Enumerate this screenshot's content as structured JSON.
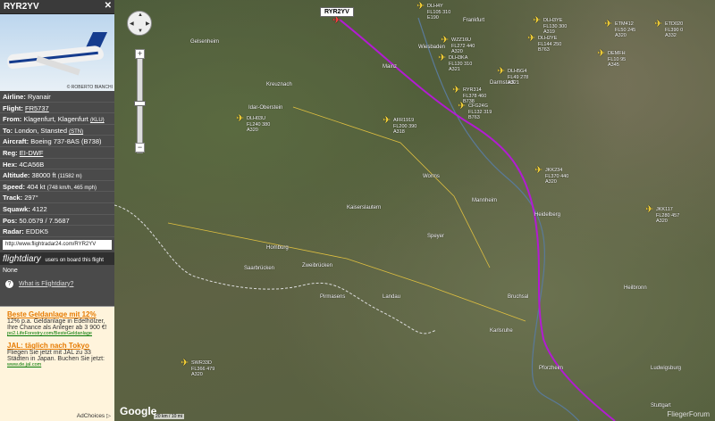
{
  "sidebar": {
    "title": "RYR2YV",
    "close": "✕",
    "photo_credit": "© ROBERTO BIANCHI",
    "rows": [
      {
        "label": "Airline:",
        "value": "Ryanair"
      },
      {
        "label": "Flight:",
        "value": "FR5737"
      },
      {
        "label": "From:",
        "value": "Klagenfurt, Klagenfurt",
        "code": "(KLU)"
      },
      {
        "label": "To:",
        "value": "London, Stansted",
        "code": "(STN)"
      },
      {
        "label": "Aircraft:",
        "value": "Boeing 737-8AS (B738)"
      },
      {
        "label": "Reg:",
        "value": "EI-DWF"
      },
      {
        "label": "Hex:",
        "value": "4CA56B"
      },
      {
        "label": "Altitude:",
        "value": "38000 ft",
        "extra": "(11582 m)"
      },
      {
        "label": "Speed:",
        "value": "404 kt",
        "extra": "(748 km/h, 465 mph)"
      },
      {
        "label": "Track:",
        "value": "297°"
      },
      {
        "label": "Squawk:",
        "value": "4122"
      },
      {
        "label": "Pos:",
        "value": "50.0579 / 7.5687"
      },
      {
        "label": "Radar:",
        "value": "EDDK5"
      }
    ],
    "url": "http://www.flightradar24.com/RYR2YV",
    "flightdiary_logo": "flightdiary",
    "flightdiary_text": "users on board this flight",
    "none": "None",
    "what_link": "What is Flightdiary?"
  },
  "ad": {
    "h1": "Beste Geldanlage mit 12%",
    "t1": "12% p.a. Geldanlage in Edelhölzer, Ihre Chance als Anleger ab 3 900 €!",
    "l1": "po2.LifeForestry.com/BesteGeldanlage",
    "h2": "JAL: täglich nach Tokyo",
    "t2": "Fliegen Sie jetzt mit JAL zu 33 Städten in Japan. Buchen Sie jetzt:",
    "l2": "www.de.jal.com",
    "adchoices": "AdChoices ▷"
  },
  "map": {
    "selected_tag": "RYR2YV",
    "google": "Google",
    "scale": "20 km / 10 mi",
    "watermark": "FliegerForum",
    "towns": [
      "Gelsenheim",
      "Mainz",
      "Wiesbaden",
      "Darmstadt",
      "Kreuznach",
      "Idar-Oberstein",
      "Kaiserslautern",
      "Worms",
      "Mannheim",
      "Heidelberg",
      "Speyer",
      "Saarbrücken",
      "Zweibrücken",
      "Homburg",
      "Pirmasens",
      "Landau",
      "Karlsruhe",
      "Pforzheim",
      "Heilbronn",
      "Ludwigsburg",
      "Stuttgart",
      "Bruchsal",
      "Frankfurt"
    ],
    "planes": [
      {
        "icon": "✈",
        "info": [
          "DLH4Y",
          "FL105 310",
          "E190"
        ]
      },
      {
        "icon": "✈",
        "info": [
          "DLH3YE",
          "FL130 300",
          "A319"
        ]
      },
      {
        "icon": "✈",
        "info": [
          "ETM412",
          "FL50 245",
          "A320"
        ]
      },
      {
        "icon": "✈",
        "info": [
          "ETD020",
          "FL390 0",
          "A332"
        ]
      },
      {
        "icon": "✈",
        "info": [
          "WZZ16U",
          "FL272 440",
          "A320"
        ]
      },
      {
        "icon": "✈",
        "info": [
          "DLH2YE",
          "FL144 250",
          "B763"
        ]
      },
      {
        "icon": "✈",
        "info": [
          "DEMFH",
          "FL10 95",
          "A345"
        ]
      },
      {
        "icon": "✈",
        "info": [
          "DLH3KA",
          "FL120 310",
          "A321"
        ]
      },
      {
        "icon": "✈",
        "info": [
          "DLH5G4",
          "FL49 278",
          "A321"
        ]
      },
      {
        "icon": "✈",
        "info": [
          "RYR314",
          "FL378 460",
          "B738"
        ]
      },
      {
        "icon": "✈",
        "info": [
          "CFG24G",
          "FL132 319",
          "B763"
        ]
      },
      {
        "icon": "✈",
        "info": [
          "DLH03U",
          "FL240 380",
          "A320"
        ]
      },
      {
        "icon": "✈",
        "info": [
          "AFR1919",
          "FL200 390",
          "A318"
        ]
      },
      {
        "icon": "✈",
        "info": [
          "JKK234",
          "FL370 440",
          "A320"
        ]
      },
      {
        "icon": "✈",
        "info": [
          "JKK117",
          "FL280 457",
          "A320"
        ]
      },
      {
        "icon": "✈",
        "info": [
          "SWR33D",
          "FL366 479",
          "A320"
        ]
      }
    ]
  }
}
